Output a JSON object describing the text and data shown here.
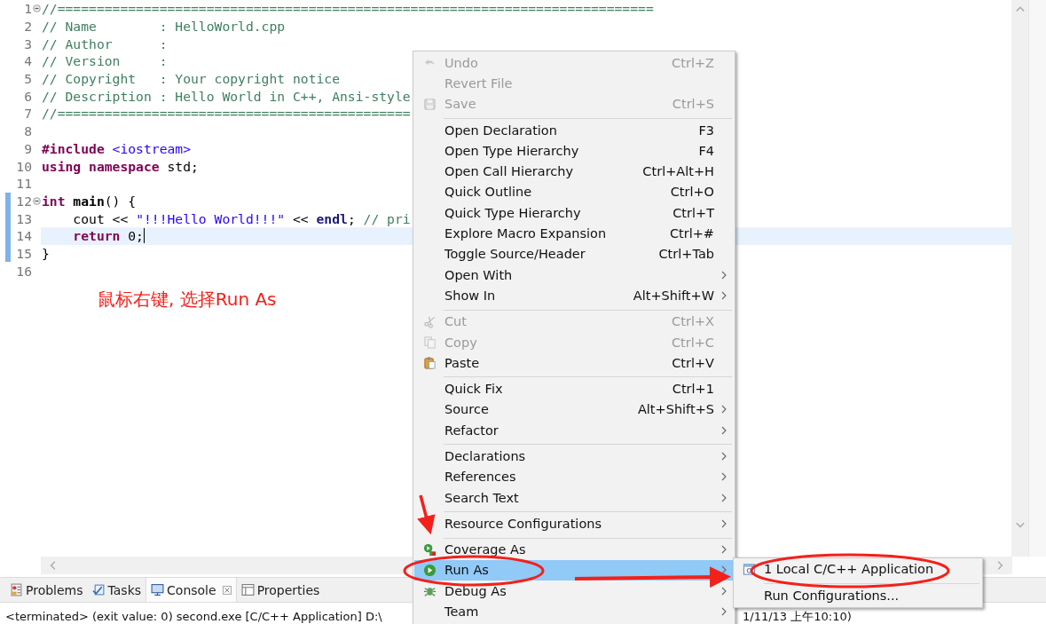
{
  "editor": {
    "lines": [
      {
        "number": "1",
        "folding": true,
        "changed": false,
        "current": false,
        "segments": [
          {
            "kind": "comment",
            "text": "//============================================================================"
          }
        ]
      },
      {
        "number": "2",
        "folding": false,
        "changed": false,
        "current": false,
        "segments": [
          {
            "kind": "comment",
            "text": "// Name        : HelloWorld.cpp"
          }
        ]
      },
      {
        "number": "3",
        "folding": false,
        "changed": false,
        "current": false,
        "segments": [
          {
            "kind": "comment",
            "text": "// Author      :"
          }
        ]
      },
      {
        "number": "4",
        "folding": false,
        "changed": false,
        "current": false,
        "segments": [
          {
            "kind": "comment",
            "text": "// Version     :"
          }
        ]
      },
      {
        "number": "5",
        "folding": false,
        "changed": false,
        "current": false,
        "segments": [
          {
            "kind": "comment",
            "text": "// Copyright   : Your copyright notice"
          }
        ]
      },
      {
        "number": "6",
        "folding": false,
        "changed": false,
        "current": false,
        "segments": [
          {
            "kind": "comment",
            "text": "// Description : Hello World in C++, Ansi-style"
          }
        ]
      },
      {
        "number": "7",
        "folding": false,
        "changed": false,
        "current": false,
        "segments": [
          {
            "kind": "comment",
            "text": "//============================================="
          }
        ]
      },
      {
        "number": "8",
        "folding": false,
        "changed": false,
        "current": false
      },
      {
        "number": "9",
        "folding": false,
        "changed": false,
        "current": false,
        "segments": [
          {
            "kind": "keyword",
            "text": "#include"
          },
          {
            "kind": "string",
            "text": " <iostream>"
          }
        ]
      },
      {
        "number": "10",
        "folding": false,
        "changed": false,
        "current": false,
        "segments": [
          {
            "kind": "keyword",
            "text": "using namespace"
          },
          {
            "kind": "plain",
            "text": " std;"
          }
        ]
      },
      {
        "number": "11",
        "folding": false,
        "changed": false,
        "current": false
      },
      {
        "number": "12",
        "folding": true,
        "changed": true,
        "current": false,
        "segments": [
          {
            "kind": "keyword",
            "text": "int"
          },
          {
            "kind": "function",
            "text": " main"
          },
          {
            "kind": "plain",
            "text": "() {"
          }
        ]
      },
      {
        "number": "13",
        "folding": false,
        "changed": true,
        "current": false,
        "segments": [
          {
            "kind": "plain",
            "text": "    cout << "
          },
          {
            "kind": "string",
            "text": "\"!!!Hello World!!!\""
          },
          {
            "kind": "plain",
            "text": " << "
          },
          {
            "kind": "symbol",
            "text": "endl"
          },
          {
            "kind": "plain",
            "text": "; "
          },
          {
            "kind": "comment",
            "text": "// pri"
          }
        ]
      },
      {
        "number": "14",
        "folding": false,
        "changed": true,
        "current": true,
        "segments": [
          {
            "kind": "keyword",
            "text": "    return"
          },
          {
            "kind": "plain",
            "text": " 0;"
          }
        ]
      },
      {
        "number": "15",
        "folding": false,
        "changed": true,
        "current": false,
        "segments": [
          {
            "kind": "plain",
            "text": "}"
          }
        ]
      },
      {
        "number": "16",
        "folding": false,
        "changed": false,
        "current": false
      }
    ]
  },
  "annotation": "鼠标右键, 选择Run As",
  "context_menu": {
    "items": [
      {
        "kind": "item",
        "label": "Undo",
        "shortcut": "Ctrl+Z",
        "disabled": true,
        "submenu": false,
        "selected": false
      },
      {
        "kind": "item",
        "label": "Revert File",
        "disabled": true,
        "submenu": false,
        "selected": false
      },
      {
        "kind": "item",
        "label": "Save",
        "shortcut": "Ctrl+S",
        "disabled": true,
        "submenu": false,
        "selected": false
      },
      {
        "kind": "separator"
      },
      {
        "kind": "item",
        "label": "Open Declaration",
        "shortcut": "F3",
        "disabled": false,
        "submenu": false,
        "selected": false
      },
      {
        "kind": "item",
        "label": "Open Type Hierarchy",
        "shortcut": "F4",
        "disabled": false,
        "submenu": false,
        "selected": false
      },
      {
        "kind": "item",
        "label": "Open Call Hierarchy",
        "shortcut": "Ctrl+Alt+H",
        "disabled": false,
        "submenu": false,
        "selected": false
      },
      {
        "kind": "item",
        "label": "Quick Outline",
        "shortcut": "Ctrl+O",
        "disabled": false,
        "submenu": false,
        "selected": false
      },
      {
        "kind": "item",
        "label": "Quick Type Hierarchy",
        "shortcut": "Ctrl+T",
        "disabled": false,
        "submenu": false,
        "selected": false
      },
      {
        "kind": "item",
        "label": "Explore Macro Expansion",
        "shortcut": "Ctrl+#",
        "disabled": false,
        "submenu": false,
        "selected": false
      },
      {
        "kind": "item",
        "label": "Toggle Source/Header",
        "shortcut": "Ctrl+Tab",
        "disabled": false,
        "submenu": false,
        "selected": false
      },
      {
        "kind": "item",
        "label": "Open With",
        "disabled": false,
        "submenu": true,
        "selected": false
      },
      {
        "kind": "item",
        "label": "Show In",
        "shortcut": "Alt+Shift+W",
        "disabled": false,
        "submenu": true,
        "selected": false
      },
      {
        "kind": "separator"
      },
      {
        "kind": "item",
        "label": "Cut",
        "shortcut": "Ctrl+X",
        "disabled": true,
        "submenu": false,
        "selected": false
      },
      {
        "kind": "item",
        "label": "Copy",
        "shortcut": "Ctrl+C",
        "disabled": true,
        "submenu": false,
        "selected": false
      },
      {
        "kind": "item",
        "label": "Paste",
        "shortcut": "Ctrl+V",
        "disabled": false,
        "submenu": false,
        "selected": false
      },
      {
        "kind": "separator"
      },
      {
        "kind": "item",
        "label": "Quick Fix",
        "shortcut": "Ctrl+1",
        "disabled": false,
        "submenu": false,
        "selected": false
      },
      {
        "kind": "item",
        "label": "Source",
        "shortcut": "Alt+Shift+S",
        "disabled": false,
        "submenu": true,
        "selected": false
      },
      {
        "kind": "item",
        "label": "Refactor",
        "disabled": false,
        "submenu": true,
        "selected": false
      },
      {
        "kind": "separator"
      },
      {
        "kind": "item",
        "label": "Declarations",
        "disabled": false,
        "submenu": true,
        "selected": false
      },
      {
        "kind": "item",
        "label": "References",
        "disabled": false,
        "submenu": true,
        "selected": false
      },
      {
        "kind": "item",
        "label": "Search Text",
        "disabled": false,
        "submenu": true,
        "selected": false
      },
      {
        "kind": "separator"
      },
      {
        "kind": "item",
        "label": "Resource Configurations",
        "disabled": false,
        "submenu": true,
        "selected": false
      },
      {
        "kind": "separator"
      },
      {
        "kind": "item",
        "label": "Coverage As",
        "disabled": false,
        "submenu": true,
        "selected": false
      },
      {
        "kind": "item",
        "label": "Run As",
        "disabled": false,
        "submenu": true,
        "selected": true
      },
      {
        "kind": "item",
        "label": "Debug As",
        "disabled": false,
        "submenu": true,
        "selected": false
      },
      {
        "kind": "item",
        "label": "Team",
        "disabled": false,
        "submenu": true,
        "selected": false
      }
    ]
  },
  "submenu": {
    "items": [
      {
        "kind": "item",
        "label": "1 Local C/C++ Application",
        "selected": false
      },
      {
        "kind": "separator"
      },
      {
        "kind": "item",
        "label": "Run Configurations...",
        "selected": false
      }
    ]
  },
  "views": {
    "tabs": [
      {
        "label": "Problems",
        "selected": false,
        "closable": false
      },
      {
        "label": "Tasks",
        "selected": false,
        "closable": false
      },
      {
        "label": "Console",
        "selected": true,
        "closable": true
      },
      {
        "label": "Properties",
        "selected": false,
        "closable": false
      }
    ]
  },
  "console": {
    "status": "<terminated> (exit value: 0) second.exe [C/C++ Application] D:\\",
    "status_tail": "1/11/13 上午10:10)"
  }
}
